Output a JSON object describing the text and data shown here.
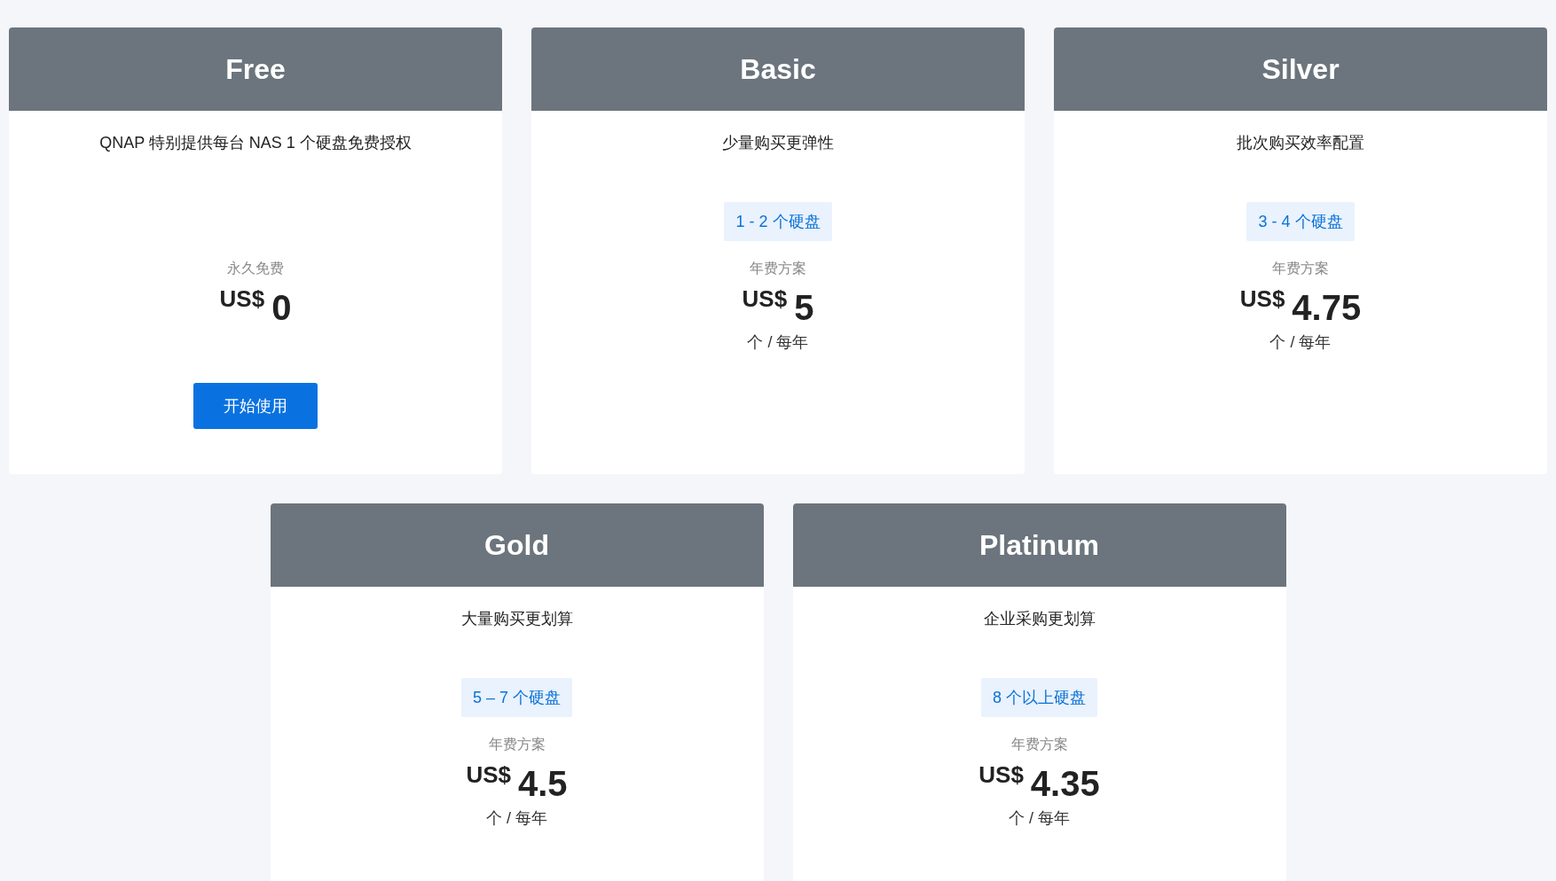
{
  "plans": [
    {
      "name": "Free",
      "description": "QNAP 特别提供每台 NAS 1 个硬盘免费授权",
      "price_label": "永久免费",
      "currency": "US$",
      "amount": "0",
      "button": "开始使用"
    },
    {
      "name": "Basic",
      "description": "少量购买更弹性",
      "badge": "1 - 2 个硬盘",
      "price_label": "年费方案",
      "currency": "US$",
      "amount": "5",
      "unit": "个 / 每年"
    },
    {
      "name": "Silver",
      "description": "批次购买效率配置",
      "badge": "3 - 4 个硬盘",
      "price_label": "年费方案",
      "currency": "US$",
      "amount": "4.75",
      "unit": "个 / 每年"
    },
    {
      "name": "Gold",
      "description": "大量购买更划算",
      "badge": "5 – 7 个硬盘",
      "price_label": "年费方案",
      "currency": "US$",
      "amount": "4.5",
      "unit": "个 / 每年"
    },
    {
      "name": "Platinum",
      "description": "企业采购更划算",
      "badge": "8 个以上硬盘",
      "price_label": "年费方案",
      "currency": "US$",
      "amount": "4.35",
      "unit": "个 / 每年"
    }
  ]
}
